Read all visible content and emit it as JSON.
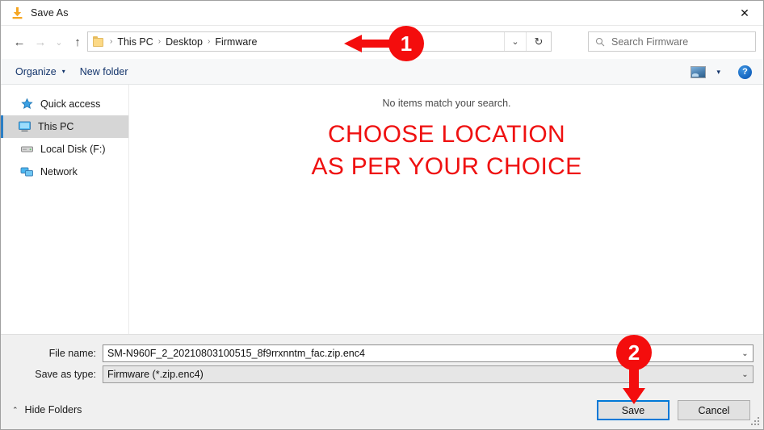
{
  "window": {
    "title": "Save As",
    "icon": "download-icon",
    "close_label": "✕"
  },
  "nav": {
    "back_icon": "←",
    "forward_icon": "→",
    "recent_icon": "⌄",
    "up_icon": "↑",
    "breadcrumb": [
      "This PC",
      "Desktop",
      "Firmware"
    ],
    "separator": "›",
    "history_chevron": "⌄",
    "refresh_icon": "↻"
  },
  "search": {
    "placeholder": "Search Firmware",
    "icon": "search-icon"
  },
  "toolbar": {
    "organize_label": "Organize",
    "organize_caret": "▾",
    "new_folder_label": "New folder",
    "view_caret": "▾",
    "help_label": "?"
  },
  "sidebar": {
    "items": [
      {
        "label": "Quick access",
        "icon": "star-icon",
        "selected": false
      },
      {
        "label": "This PC",
        "icon": "monitor-icon",
        "selected": true
      },
      {
        "label": "Local Disk (F:)",
        "icon": "drive-icon",
        "selected": false
      },
      {
        "label": "Network",
        "icon": "network-icon",
        "selected": false
      }
    ]
  },
  "content": {
    "empty_message": "No items match your search.",
    "annotation_line1": "CHOOSE LOCATION",
    "annotation_line2": "AS PER YOUR CHOICE"
  },
  "form": {
    "file_name_label": "File name:",
    "file_name_value": "SM-N960F_2_20210803100515_8f9rrxnntm_fac.zip.enc4",
    "save_as_type_label": "Save as type:",
    "save_as_type_value": "Firmware (*.zip.enc4)",
    "chevron": "⌄"
  },
  "footer": {
    "hide_folders_label": "Hide Folders",
    "hide_folders_caret": "⌃",
    "save_label": "Save",
    "cancel_label": "Cancel"
  },
  "markers": [
    {
      "number": "1",
      "points_to": "address-bar"
    },
    {
      "number": "2",
      "points_to": "save-button"
    }
  ],
  "colors": {
    "marker_red": "#f40d0d",
    "annotation_red": "#ef1111",
    "focus_blue": "#0078d7",
    "selection_grey": "#d6d6d6",
    "panel_grey": "#f0f0f0"
  }
}
